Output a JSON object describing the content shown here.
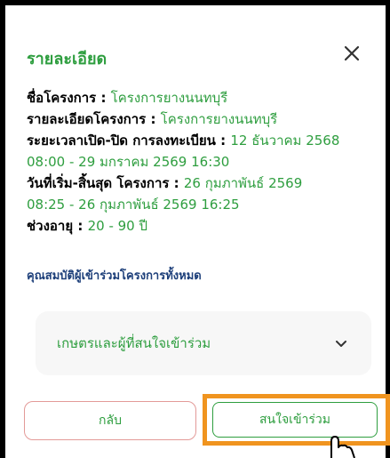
{
  "dialog": {
    "title": "รายละเอียด",
    "close_icon": "close-icon"
  },
  "details": [
    {
      "label": "ชื่อโครงการ : ",
      "value": "โครงการยางนนทบุรี"
    },
    {
      "label": "รายละเอียดโครงการ : ",
      "value": "โครงการยางนนทบุรี"
    },
    {
      "label": "ระยะเวลาเปิด-ปิด การลงทะเบียน : ",
      "value": "12 ธันวาคม 2568",
      "value_line2": "08:00 - 29 มกราคม 2569 16:30"
    },
    {
      "label": "วันที่เริ่ม-สิ้นสุด โครงการ : ",
      "value": "26 กุมภาพันธ์ 2569",
      "value_line2": "08:25 - 26 กุมภาพันธ์ 2569 16:25"
    },
    {
      "label": "ช่วงอายุ : ",
      "value": "20 - 90 ปี"
    }
  ],
  "qualifications_link": "คุณสมบัติผู้เข้าร่วมโครงการทั้งหมด",
  "accordion": {
    "label": "เกษตรและผู้ที่สนใจเข้าร่วม",
    "icon": "chevron-down-icon"
  },
  "buttons": {
    "back": "กลับ",
    "interest": "สนใจเข้าร่วม"
  },
  "colors": {
    "accent_green": "#2e9e3f",
    "link_blue": "#1d3f7a",
    "highlight_orange": "#f0941f",
    "back_border": "#e39a98"
  }
}
